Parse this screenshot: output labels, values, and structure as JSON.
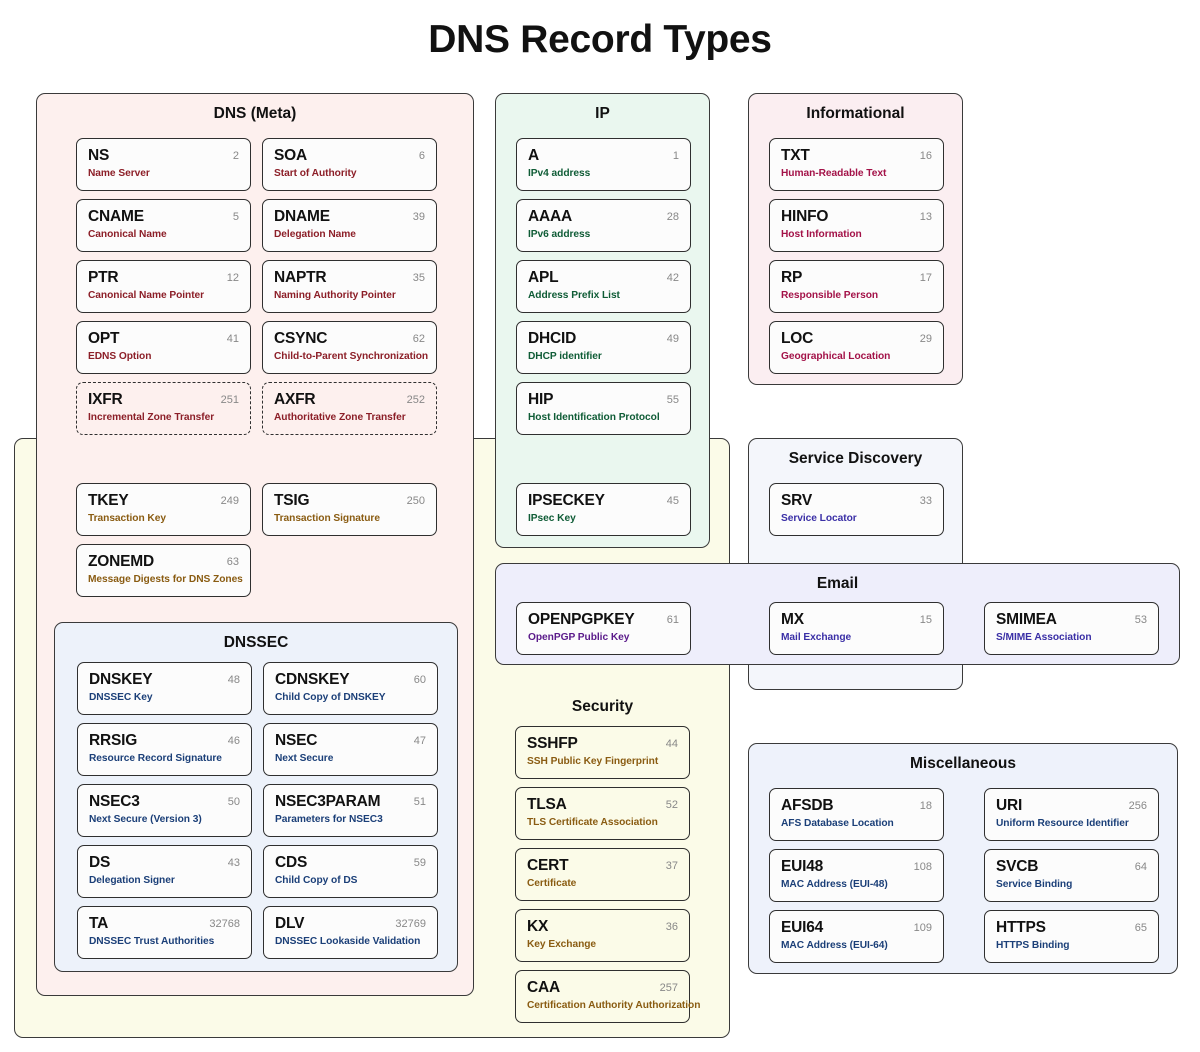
{
  "title": "DNS Record Types",
  "sections": {
    "meta": {
      "title": "DNS (Meta)"
    },
    "ip": {
      "title": "IP"
    },
    "info": {
      "title": "Informational"
    },
    "srvdisc": {
      "title": "Service Discovery"
    },
    "email": {
      "title": "Email"
    },
    "dnssec": {
      "title": "DNSSEC"
    },
    "security": {
      "title": "Security"
    },
    "misc": {
      "title": "Miscellaneous"
    }
  },
  "records": {
    "ns": {
      "code": "NS",
      "num": "2",
      "desc": "Name Server"
    },
    "soa": {
      "code": "SOA",
      "num": "6",
      "desc": "Start of Authority"
    },
    "cname": {
      "code": "CNAME",
      "num": "5",
      "desc": "Canonical Name"
    },
    "dname": {
      "code": "DNAME",
      "num": "39",
      "desc": "Delegation Name"
    },
    "ptr": {
      "code": "PTR",
      "num": "12",
      "desc": "Canonical Name Pointer"
    },
    "naptr": {
      "code": "NAPTR",
      "num": "35",
      "desc": "Naming Authority Pointer"
    },
    "opt": {
      "code": "OPT",
      "num": "41",
      "desc": "EDNS Option"
    },
    "csync": {
      "code": "CSYNC",
      "num": "62",
      "desc": "Child-to-Parent Synchronization"
    },
    "ixfr": {
      "code": "IXFR",
      "num": "251",
      "desc": "Incremental Zone Transfer"
    },
    "axfr": {
      "code": "AXFR",
      "num": "252",
      "desc": "Authoritative Zone Transfer"
    },
    "tkey": {
      "code": "TKEY",
      "num": "249",
      "desc": "Transaction Key"
    },
    "tsig": {
      "code": "TSIG",
      "num": "250",
      "desc": "Transaction Signature"
    },
    "zonemd": {
      "code": "ZONEMD",
      "num": "63",
      "desc": "Message Digests for DNS Zones"
    },
    "a": {
      "code": "A",
      "num": "1",
      "desc": "IPv4 address"
    },
    "aaaa": {
      "code": "AAAA",
      "num": "28",
      "desc": "IPv6 address"
    },
    "apl": {
      "code": "APL",
      "num": "42",
      "desc": "Address Prefix List"
    },
    "dhcid": {
      "code": "DHCID",
      "num": "49",
      "desc": "DHCP identifier"
    },
    "hip": {
      "code": "HIP",
      "num": "55",
      "desc": "Host Identification Protocol"
    },
    "ipseckey": {
      "code": "IPSECKEY",
      "num": "45",
      "desc": "IPsec Key"
    },
    "txt": {
      "code": "TXT",
      "num": "16",
      "desc": "Human-Readable Text"
    },
    "hinfo": {
      "code": "HINFO",
      "num": "13",
      "desc": "Host Information"
    },
    "rp": {
      "code": "RP",
      "num": "17",
      "desc": "Responsible Person"
    },
    "loc": {
      "code": "LOC",
      "num": "29",
      "desc": "Geographical Location"
    },
    "srv": {
      "code": "SRV",
      "num": "33",
      "desc": "Service Locator"
    },
    "openpgpkey": {
      "code": "OPENPGPKEY",
      "num": "61",
      "desc": "OpenPGP Public Key"
    },
    "mx": {
      "code": "MX",
      "num": "15",
      "desc": "Mail Exchange"
    },
    "smimea": {
      "code": "SMIMEA",
      "num": "53",
      "desc": "S/MIME Association"
    },
    "dnskey": {
      "code": "DNSKEY",
      "num": "48",
      "desc": "DNSSEC Key"
    },
    "cdnskey": {
      "code": "CDNSKEY",
      "num": "60",
      "desc": "Child Copy of DNSKEY"
    },
    "rrsig": {
      "code": "RRSIG",
      "num": "46",
      "desc": "Resource Record Signature"
    },
    "nsec": {
      "code": "NSEC",
      "num": "47",
      "desc": "Next Secure"
    },
    "nsec3": {
      "code": "NSEC3",
      "num": "50",
      "desc": "Next Secure (Version 3)"
    },
    "nsec3param": {
      "code": "NSEC3PARAM",
      "num": "51",
      "desc": "Parameters for NSEC3"
    },
    "ds": {
      "code": "DS",
      "num": "43",
      "desc": "Delegation Signer"
    },
    "cds": {
      "code": "CDS",
      "num": "59",
      "desc": "Child Copy of DS"
    },
    "ta": {
      "code": "TA",
      "num": "32768",
      "desc": "DNSSEC Trust Authorities"
    },
    "dlv": {
      "code": "DLV",
      "num": "32769",
      "desc": "DNSSEC Lookaside Validation"
    },
    "sshfp": {
      "code": "SSHFP",
      "num": "44",
      "desc": "SSH Public Key Fingerprint"
    },
    "tlsa": {
      "code": "TLSA",
      "num": "52",
      "desc": "TLS Certificate Association"
    },
    "cert": {
      "code": "CERT",
      "num": "37",
      "desc": "Certificate"
    },
    "kx": {
      "code": "KX",
      "num": "36",
      "desc": "Key Exchange"
    },
    "caa": {
      "code": "CAA",
      "num": "257",
      "desc": "Certification Authority Authorization"
    },
    "afsdb": {
      "code": "AFSDB",
      "num": "18",
      "desc": "AFS Database Location"
    },
    "uri": {
      "code": "URI",
      "num": "256",
      "desc": "Uniform Resource Identifier"
    },
    "eui48": {
      "code": "EUI48",
      "num": "108",
      "desc": "MAC Address (EUI-48)"
    },
    "svcb": {
      "code": "SVCB",
      "num": "64",
      "desc": "Service Binding"
    },
    "eui64": {
      "code": "EUI64",
      "num": "109",
      "desc": "MAC Address (EUI-64)"
    },
    "https": {
      "code": "HTTPS",
      "num": "65",
      "desc": "HTTPS Binding"
    }
  },
  "colors": {
    "meta_bg": "#fdf0ee",
    "meta_text": "#8c1f28",
    "ip_bg": "#eaf7ef",
    "ip_text": "#0f5c36",
    "info_bg": "#fbeef1",
    "info_text": "#a31248",
    "srvdisc_bg": "#f4f6fb",
    "srvdisc_text": "#3a2fa6",
    "email_bg": "#eeeefb",
    "email_text": "#3a2fa6",
    "dnssec_bg": "#edf2fa",
    "dnssec_text": "#1b3f78",
    "security_bg": "#fbfbe8",
    "security_text": "#8a5c12",
    "misc_bg": "#eef2fb",
    "misc_text": "#1b3f78",
    "border": "#2f2f2f",
    "card_bg": "#fcfcfc",
    "number": "#888888"
  }
}
